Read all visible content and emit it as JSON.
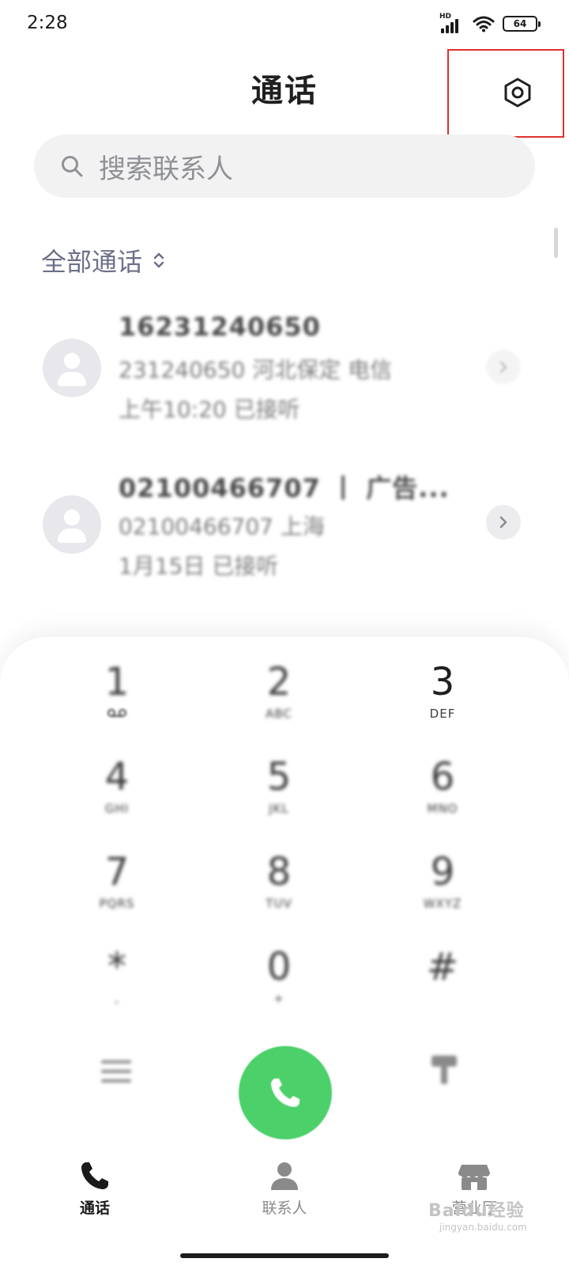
{
  "status_bar": {
    "time": "2:28",
    "network": "HD",
    "battery": "64"
  },
  "header": {
    "title": "通话",
    "settings_icon": "settings-hex-icon",
    "highlight_color": "#e0302d"
  },
  "search": {
    "placeholder": "搜索联系人",
    "icon": "search-icon"
  },
  "filter": {
    "label": "全部通话",
    "icon": "chevron-up-down-icon"
  },
  "call_log": [
    {
      "name": "16231240650",
      "line1": "231240650 河北保定 电信",
      "line2": "上午10:20 已接听"
    },
    {
      "name": "02100466707 丨 广告...",
      "line1": "02100466707 上海",
      "line2": "1月15日 已接听"
    }
  ],
  "dialpad": {
    "keys": [
      {
        "digit": "1",
        "letters": ""
      },
      {
        "digit": "2",
        "letters": "ABC"
      },
      {
        "digit": "3",
        "letters": "DEF"
      },
      {
        "digit": "4",
        "letters": "GHI"
      },
      {
        "digit": "5",
        "letters": "JKL"
      },
      {
        "digit": "6",
        "letters": "MNO"
      },
      {
        "digit": "7",
        "letters": "PQRS"
      },
      {
        "digit": "8",
        "letters": "TUV"
      },
      {
        "digit": "9",
        "letters": "WXYZ"
      },
      {
        "digit": "*",
        "letters": ","
      },
      {
        "digit": "0",
        "letters": "+"
      },
      {
        "digit": "#",
        "letters": ""
      }
    ],
    "call_color": "#4cd06a"
  },
  "tabs": [
    {
      "label": "通话",
      "icon": "phone-icon",
      "active": true
    },
    {
      "label": "联系人",
      "icon": "person-icon",
      "active": false
    },
    {
      "label": "营业厅",
      "icon": "store-icon",
      "active": false
    }
  ],
  "watermark": {
    "brand": "Baidu经验",
    "url": "jingyan.baidu.com"
  }
}
